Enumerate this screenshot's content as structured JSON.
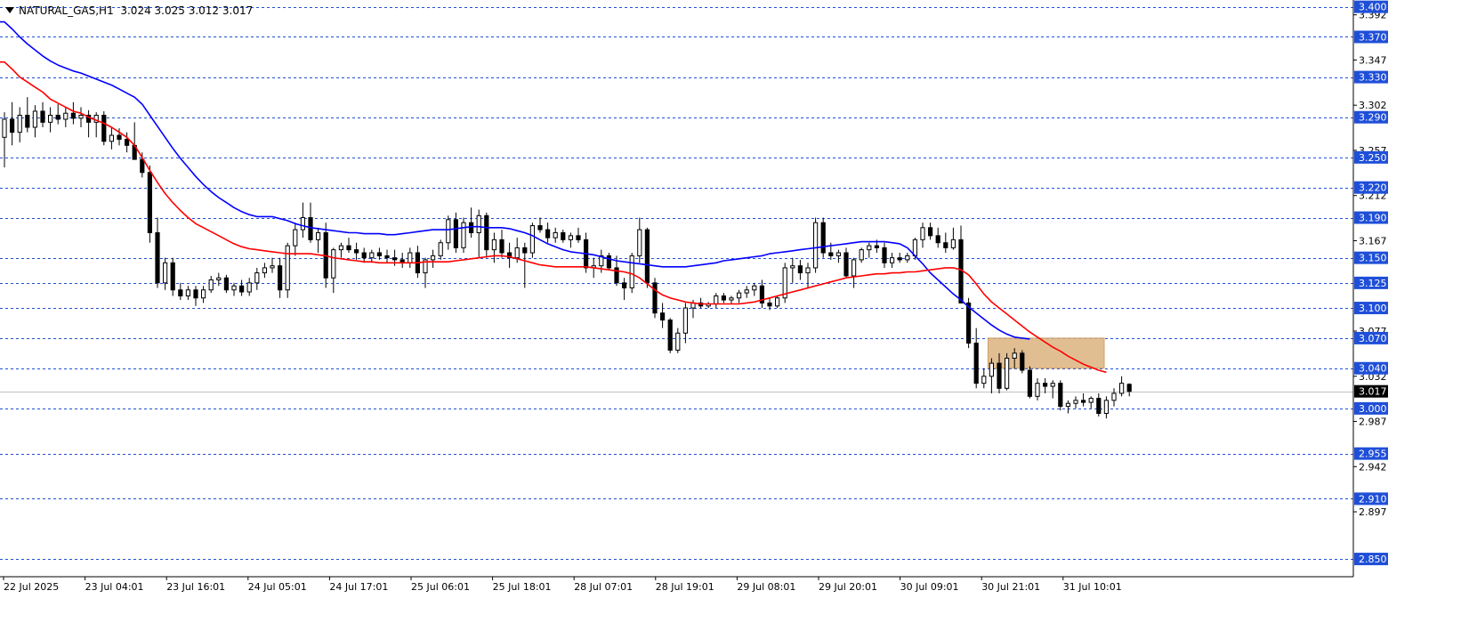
{
  "header": {
    "symbol": "NATURAL_GAS,H1",
    "ohlc": "3.024 3.025 3.012 3.017"
  },
  "colors": {
    "background": "#ffffff",
    "grid_level": "#1f4fd8",
    "ma_fast": "#ff0000",
    "ma_slow": "#0000ff",
    "zone_fill": "#deb887",
    "bear_body": "#000000",
    "bull_body": "#ffffff",
    "candle_outline": "#000000",
    "price_tag_bg": "#000000"
  },
  "chart_data": {
    "type": "candlestick",
    "symbol": "NATURAL_GAS",
    "timeframe": "H1",
    "ylim": [
      2.835,
      3.405
    ],
    "current_price": "3.017",
    "price_axis_labels": [
      "3.392",
      "3.347",
      "3.302",
      "3.257",
      "3.212",
      "3.167",
      "3.077",
      "3.032",
      "2.987",
      "2.942",
      "2.897"
    ],
    "level_lines": [
      "3.400",
      "3.370",
      "3.330",
      "3.290",
      "3.250",
      "3.220",
      "3.190",
      "3.150",
      "3.125",
      "3.100",
      "3.070",
      "3.040",
      "3.000",
      "2.955",
      "2.910",
      "2.850"
    ],
    "time_labels": [
      "22 Jul 2025",
      "23 Jul 04:01",
      "23 Jul 16:01",
      "24 Jul 05:01",
      "24 Jul 17:01",
      "25 Jul 06:01",
      "25 Jul 18:01",
      "28 Jul 07:01",
      "28 Jul 19:01",
      "29 Jul 08:01",
      "29 Jul 20:01",
      "30 Jul 09:01",
      "30 Jul 21:01",
      "31 Jul 10:01"
    ],
    "supply_zone": {
      "price_low": 3.04,
      "price_high": 3.07
    },
    "candles": [
      [
        3.27,
        3.295,
        3.24,
        3.288
      ],
      [
        3.288,
        3.305,
        3.262,
        3.275
      ],
      [
        3.275,
        3.3,
        3.265,
        3.292
      ],
      [
        3.292,
        3.31,
        3.275,
        3.28
      ],
      [
        3.28,
        3.302,
        3.27,
        3.296
      ],
      [
        3.296,
        3.305,
        3.28,
        3.285
      ],
      [
        3.285,
        3.3,
        3.275,
        3.292
      ],
      [
        3.292,
        3.303,
        3.283,
        3.288
      ],
      [
        3.288,
        3.3,
        3.28,
        3.294
      ],
      [
        3.294,
        3.305,
        3.283,
        3.289
      ],
      [
        3.289,
        3.3,
        3.28,
        3.292
      ],
      [
        3.292,
        3.297,
        3.27,
        3.285
      ],
      [
        3.285,
        3.295,
        3.27,
        3.292
      ],
      [
        3.292,
        3.296,
        3.262,
        3.266
      ],
      [
        3.266,
        3.28,
        3.258,
        3.272
      ],
      [
        3.272,
        3.279,
        3.262,
        3.268
      ],
      [
        3.268,
        3.275,
        3.255,
        3.262
      ],
      [
        3.262,
        3.285,
        3.255,
        3.248
      ],
      [
        3.248,
        3.255,
        3.23,
        3.235
      ],
      [
        3.235,
        3.242,
        3.165,
        3.175
      ],
      [
        3.175,
        3.19,
        3.12,
        3.125
      ],
      [
        3.125,
        3.15,
        3.118,
        3.145
      ],
      [
        3.145,
        3.15,
        3.112,
        3.118
      ],
      [
        3.118,
        3.125,
        3.108,
        3.112
      ],
      [
        3.112,
        3.122,
        3.108,
        3.118
      ],
      [
        3.118,
        3.122,
        3.102,
        3.11
      ],
      [
        3.11,
        3.122,
        3.105,
        3.118
      ],
      [
        3.118,
        3.132,
        3.115,
        3.128
      ],
      [
        3.128,
        3.135,
        3.122,
        3.13
      ],
      [
        3.13,
        3.133,
        3.115,
        3.118
      ],
      [
        3.118,
        3.125,
        3.112,
        3.122
      ],
      [
        3.122,
        3.128,
        3.112,
        3.116
      ],
      [
        3.116,
        3.13,
        3.112,
        3.125
      ],
      [
        3.125,
        3.14,
        3.118,
        3.135
      ],
      [
        3.135,
        3.145,
        3.13,
        3.14
      ],
      [
        3.14,
        3.15,
        3.135,
        3.142
      ],
      [
        3.142,
        3.15,
        3.11,
        3.118
      ],
      [
        3.118,
        3.165,
        3.11,
        3.162
      ],
      [
        3.162,
        3.185,
        3.152,
        3.178
      ],
      [
        3.178,
        3.205,
        3.17,
        3.19
      ],
      [
        3.19,
        3.205,
        3.165,
        3.168
      ],
      [
        3.168,
        3.18,
        3.155,
        3.175
      ],
      [
        3.175,
        3.185,
        3.12,
        3.13
      ],
      [
        3.13,
        3.16,
        3.115,
        3.158
      ],
      [
        3.158,
        3.165,
        3.15,
        3.162
      ],
      [
        3.162,
        3.17,
        3.155,
        3.158
      ],
      [
        3.158,
        3.165,
        3.148,
        3.155
      ],
      [
        3.155,
        3.16,
        3.145,
        3.15
      ],
      [
        3.15,
        3.158,
        3.145,
        3.155
      ],
      [
        3.155,
        3.16,
        3.148,
        3.152
      ],
      [
        3.152,
        3.158,
        3.145,
        3.15
      ],
      [
        3.15,
        3.158,
        3.142,
        3.148
      ],
      [
        3.148,
        3.155,
        3.14,
        3.145
      ],
      [
        3.145,
        3.16,
        3.14,
        3.155
      ],
      [
        3.155,
        3.162,
        3.13,
        3.135
      ],
      [
        3.135,
        3.15,
        3.12,
        3.148
      ],
      [
        3.148,
        3.158,
        3.14,
        3.152
      ],
      [
        3.152,
        3.168,
        3.148,
        3.165
      ],
      [
        3.165,
        3.192,
        3.158,
        3.188
      ],
      [
        3.188,
        3.195,
        3.155,
        3.16
      ],
      [
        3.16,
        3.19,
        3.155,
        3.185
      ],
      [
        3.185,
        3.2,
        3.17,
        3.175
      ],
      [
        3.175,
        3.198,
        3.15,
        3.192
      ],
      [
        3.192,
        3.195,
        3.15,
        3.158
      ],
      [
        3.158,
        3.175,
        3.145,
        3.168
      ],
      [
        3.168,
        3.178,
        3.15,
        3.155
      ],
      [
        3.155,
        3.165,
        3.14,
        3.15
      ],
      [
        3.15,
        3.17,
        3.145,
        3.16
      ],
      [
        3.16,
        3.165,
        3.12,
        3.155
      ],
      [
        3.155,
        3.185,
        3.15,
        3.182
      ],
      [
        3.182,
        3.19,
        3.175,
        3.178
      ],
      [
        3.178,
        3.185,
        3.165,
        3.17
      ],
      [
        3.17,
        3.18,
        3.165,
        3.175
      ],
      [
        3.175,
        3.178,
        3.165,
        3.168
      ],
      [
        3.168,
        3.175,
        3.16,
        3.172
      ],
      [
        3.172,
        3.18,
        3.165,
        3.168
      ],
      [
        3.168,
        3.175,
        3.135,
        3.14
      ],
      [
        3.14,
        3.15,
        3.13,
        3.142
      ],
      [
        3.142,
        3.158,
        3.135,
        3.152
      ],
      [
        3.152,
        3.155,
        3.138,
        3.14
      ],
      [
        3.14,
        3.152,
        3.122,
        3.125
      ],
      [
        3.125,
        3.13,
        3.108,
        3.12
      ],
      [
        3.12,
        3.155,
        3.115,
        3.152
      ],
      [
        3.152,
        3.19,
        3.145,
        3.178
      ],
      [
        3.178,
        3.18,
        3.12,
        3.125
      ],
      [
        3.125,
        3.13,
        3.09,
        3.095
      ],
      [
        3.095,
        3.105,
        3.08,
        3.088
      ],
      [
        3.088,
        3.09,
        3.055,
        3.058
      ],
      [
        3.058,
        3.08,
        3.055,
        3.075
      ],
      [
        3.075,
        3.105,
        3.065,
        3.1
      ],
      [
        3.1,
        3.108,
        3.09,
        3.105
      ],
      [
        3.105,
        3.11,
        3.1,
        3.102
      ],
      [
        3.102,
        3.106,
        3.1,
        3.104
      ],
      [
        3.104,
        3.115,
        3.1,
        3.112
      ],
      [
        3.112,
        3.115,
        3.105,
        3.108
      ],
      [
        3.108,
        3.112,
        3.104,
        3.11
      ],
      [
        3.11,
        3.118,
        3.105,
        3.115
      ],
      [
        3.115,
        3.122,
        3.11,
        3.118
      ],
      [
        3.118,
        3.125,
        3.112,
        3.122
      ],
      [
        3.122,
        3.128,
        3.1,
        3.105
      ],
      [
        3.105,
        3.11,
        3.098,
        3.102
      ],
      [
        3.102,
        3.112,
        3.1,
        3.11
      ],
      [
        3.11,
        3.145,
        3.105,
        3.14
      ],
      [
        3.14,
        3.15,
        3.125,
        3.142
      ],
      [
        3.142,
        3.148,
        3.128,
        3.135
      ],
      [
        3.135,
        3.145,
        3.12,
        3.14
      ],
      [
        3.14,
        3.19,
        3.135,
        3.185
      ],
      [
        3.185,
        3.19,
        3.15,
        3.155
      ],
      [
        3.155,
        3.165,
        3.148,
        3.152
      ],
      [
        3.152,
        3.158,
        3.145,
        3.155
      ],
      [
        3.155,
        3.16,
        3.13,
        3.132
      ],
      [
        3.132,
        3.15,
        3.12,
        3.148
      ],
      [
        3.148,
        3.16,
        3.145,
        3.158
      ],
      [
        3.158,
        3.165,
        3.15,
        3.162
      ],
      [
        3.162,
        3.168,
        3.155,
        3.16
      ],
      [
        3.16,
        3.165,
        3.14,
        3.145
      ],
      [
        3.145,
        3.155,
        3.14,
        3.15
      ],
      [
        3.15,
        3.155,
        3.145,
        3.148
      ],
      [
        3.148,
        3.155,
        3.145,
        3.152
      ],
      [
        3.152,
        3.17,
        3.148,
        3.168
      ],
      [
        3.168,
        3.185,
        3.16,
        3.18
      ],
      [
        3.18,
        3.185,
        3.168,
        3.172
      ],
      [
        3.172,
        3.18,
        3.16,
        3.165
      ],
      [
        3.165,
        3.175,
        3.155,
        3.16
      ],
      [
        3.16,
        3.18,
        3.158,
        3.168
      ],
      [
        3.168,
        3.182,
        3.14,
        3.105
      ],
      [
        3.105,
        3.11,
        3.06,
        3.065
      ],
      [
        3.065,
        3.08,
        3.02,
        3.025
      ],
      [
        3.025,
        3.04,
        3.02,
        3.032
      ],
      [
        3.032,
        3.05,
        3.015,
        3.045
      ],
      [
        3.045,
        3.055,
        3.015,
        3.02
      ],
      [
        3.02,
        3.055,
        3.018,
        3.05
      ],
      [
        3.05,
        3.06,
        3.04,
        3.055
      ],
      [
        3.055,
        3.058,
        3.035,
        3.038
      ],
      [
        3.038,
        3.042,
        3.01,
        3.012
      ],
      [
        3.012,
        3.03,
        3.008,
        3.025
      ],
      [
        3.025,
        3.03,
        3.015,
        3.022
      ],
      [
        3.022,
        3.028,
        3.01,
        3.025
      ],
      [
        3.025,
        3.028,
        2.998,
        3.002
      ],
      [
        3.002,
        3.008,
        2.995,
        3.005
      ],
      [
        3.005,
        3.012,
        3.0,
        3.008
      ],
      [
        3.008,
        3.015,
        3.002,
        3.006
      ],
      [
        3.006,
        3.012,
        3.0,
        3.01
      ],
      [
        3.01,
        3.015,
        2.992,
        2.995
      ],
      [
        2.995,
        3.012,
        2.99,
        3.008
      ],
      [
        3.008,
        3.02,
        3.002,
        3.015
      ],
      [
        3.015,
        3.032,
        3.012,
        3.025
      ],
      [
        3.024,
        3.025,
        3.012,
        3.017
      ]
    ],
    "ma_fast": [
      3.345,
      3.338,
      3.33,
      3.325,
      3.32,
      3.315,
      3.308,
      3.304,
      3.3,
      3.296,
      3.294,
      3.29,
      3.287,
      3.284,
      3.28,
      3.275,
      3.27,
      3.262,
      3.25,
      3.237,
      3.225,
      3.214,
      3.205,
      3.197,
      3.19,
      3.184,
      3.18,
      3.176,
      3.172,
      3.168,
      3.164,
      3.161,
      3.159,
      3.158,
      3.157,
      3.156,
      3.155,
      3.154,
      3.154,
      3.154,
      3.154,
      3.153,
      3.152,
      3.15,
      3.149,
      3.148,
      3.147,
      3.146,
      3.146,
      3.145,
      3.145,
      3.145,
      3.145,
      3.145,
      3.145,
      3.146,
      3.146,
      3.146,
      3.146,
      3.147,
      3.148,
      3.149,
      3.15,
      3.151,
      3.152,
      3.152,
      3.151,
      3.149,
      3.147,
      3.145,
      3.143,
      3.142,
      3.141,
      3.141,
      3.141,
      3.141,
      3.141,
      3.14,
      3.139,
      3.138,
      3.137,
      3.136,
      3.134,
      3.13,
      3.124,
      3.118,
      3.113,
      3.11,
      3.108,
      3.106,
      3.105,
      3.104,
      3.104,
      3.104,
      3.104,
      3.104,
      3.104,
      3.105,
      3.106,
      3.108,
      3.11,
      3.112,
      3.114,
      3.116,
      3.118,
      3.12,
      3.122,
      3.124,
      3.126,
      3.128,
      3.13,
      3.131,
      3.132,
      3.133,
      3.134,
      3.134,
      3.135,
      3.135,
      3.136,
      3.136,
      3.137,
      3.138,
      3.139,
      3.14,
      3.14,
      3.138,
      3.133,
      3.124,
      3.114,
      3.106,
      3.1,
      3.094,
      3.088,
      3.082,
      3.076,
      3.071,
      3.066,
      3.061,
      3.057,
      3.052,
      3.048,
      3.044,
      3.041,
      3.038,
      3.036
    ],
    "ma_slow": [
      3.385,
      3.378,
      3.37,
      3.363,
      3.357,
      3.351,
      3.346,
      3.342,
      3.339,
      3.336,
      3.334,
      3.331,
      3.328,
      3.325,
      3.322,
      3.318,
      3.314,
      3.31,
      3.303,
      3.292,
      3.281,
      3.27,
      3.259,
      3.249,
      3.24,
      3.231,
      3.223,
      3.216,
      3.21,
      3.205,
      3.2,
      3.196,
      3.193,
      3.191,
      3.191,
      3.191,
      3.189,
      3.187,
      3.184,
      3.182,
      3.18,
      3.179,
      3.178,
      3.177,
      3.176,
      3.175,
      3.175,
      3.174,
      3.174,
      3.174,
      3.173,
      3.173,
      3.174,
      3.175,
      3.176,
      3.177,
      3.178,
      3.178,
      3.178,
      3.179,
      3.18,
      3.181,
      3.181,
      3.18,
      3.18,
      3.18,
      3.179,
      3.177,
      3.175,
      3.172,
      3.168,
      3.164,
      3.161,
      3.158,
      3.156,
      3.155,
      3.154,
      3.153,
      3.151,
      3.149,
      3.147,
      3.146,
      3.145,
      3.144,
      3.143,
      3.142,
      3.141,
      3.141,
      3.141,
      3.141,
      3.142,
      3.143,
      3.144,
      3.145,
      3.147,
      3.148,
      3.149,
      3.15,
      3.151,
      3.152,
      3.154,
      3.155,
      3.156,
      3.157,
      3.158,
      3.159,
      3.16,
      3.161,
      3.162,
      3.163,
      3.164,
      3.165,
      3.166,
      3.166,
      3.166,
      3.166,
      3.165,
      3.164,
      3.16,
      3.152,
      3.144,
      3.135,
      3.128,
      3.121,
      3.114,
      3.108,
      3.101,
      3.095,
      3.089,
      3.083,
      3.078,
      3.074,
      3.071,
      3.07,
      3.069
    ]
  }
}
